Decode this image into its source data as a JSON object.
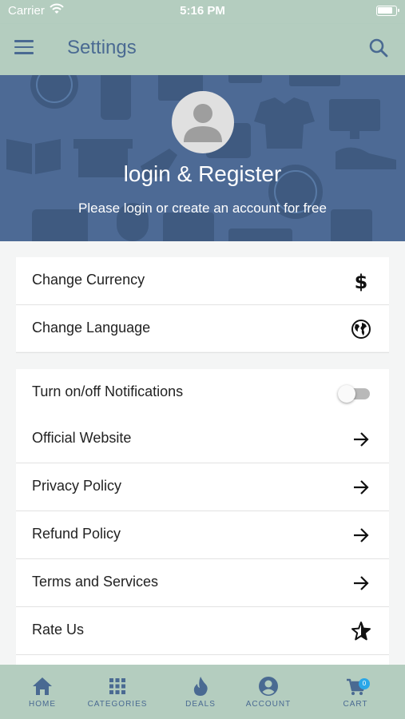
{
  "status_bar": {
    "carrier": "Carrier",
    "time": "5:16 PM"
  },
  "app_bar": {
    "title": "Settings"
  },
  "hero": {
    "title": "login & Register",
    "subtitle": "Please login or create an account for free"
  },
  "section_one": [
    {
      "label": "Change Currency",
      "icon": "dollar-icon"
    },
    {
      "label": "Change Language",
      "icon": "globe-icon"
    }
  ],
  "section_two": {
    "notifications": {
      "label": "Turn on/off Notifications",
      "enabled": false
    },
    "items": [
      {
        "label": "Official Website",
        "icon": "arrow-right-icon"
      },
      {
        "label": "Privacy Policy",
        "icon": "arrow-right-icon"
      },
      {
        "label": "Refund Policy",
        "icon": "arrow-right-icon"
      },
      {
        "label": "Terms and Services",
        "icon": "arrow-right-icon"
      },
      {
        "label": "Rate Us",
        "icon": "star-icon"
      }
    ]
  },
  "bottom_nav": [
    {
      "label": "HOME",
      "icon": "home-icon"
    },
    {
      "label": "CATEGORIES",
      "icon": "grid-icon"
    },
    {
      "label": "DEALS",
      "icon": "flame-icon"
    },
    {
      "label": "ACCOUNT",
      "icon": "account-icon"
    },
    {
      "label": "CART",
      "icon": "cart-icon",
      "badge": "0"
    }
  ],
  "colors": {
    "primary": "#4a6a92",
    "bar": "#b4cdbf",
    "hero": "#4d6a95",
    "badge": "#2aa7e8"
  }
}
